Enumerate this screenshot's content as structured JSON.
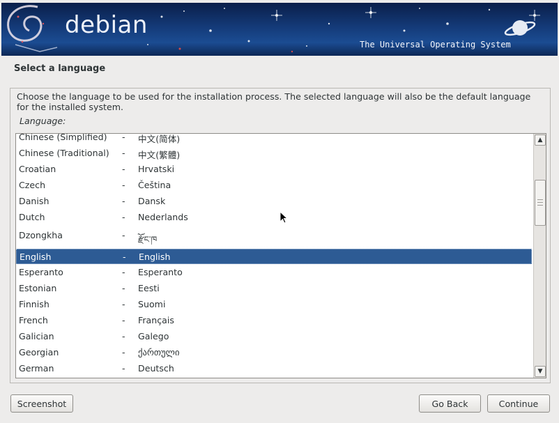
{
  "header": {
    "logo_text": "debian",
    "tagline": "The Universal Operating System"
  },
  "page": {
    "title": "Select a language",
    "description": "Choose the language to be used for the installation process. The selected language will also be the default language for the installed system.",
    "list_label": "Language:"
  },
  "languages": [
    {
      "name": "Chinese (Simplified)",
      "native": "中文(简体)"
    },
    {
      "name": "Chinese (Traditional)",
      "native": "中文(繁體)"
    },
    {
      "name": "Croatian",
      "native": "Hrvatski"
    },
    {
      "name": "Czech",
      "native": "Čeština"
    },
    {
      "name": "Danish",
      "native": "Dansk"
    },
    {
      "name": "Dutch",
      "native": "Nederlands"
    },
    {
      "name": "Dzongkha",
      "native": "རྫོང་ཁ"
    },
    {
      "name": "English",
      "native": "English",
      "selected": true
    },
    {
      "name": "Esperanto",
      "native": "Esperanto"
    },
    {
      "name": "Estonian",
      "native": "Eesti"
    },
    {
      "name": "Finnish",
      "native": "Suomi"
    },
    {
      "name": "French",
      "native": "Français"
    },
    {
      "name": "Galician",
      "native": "Galego"
    },
    {
      "name": "Georgian",
      "native": "ქართული"
    },
    {
      "name": "German",
      "native": "Deutsch"
    }
  ],
  "separator": "-",
  "buttons": {
    "screenshot": "Screenshot",
    "back": "Go Back",
    "continue": "Continue"
  },
  "colors": {
    "selection": "#2d5b94",
    "banner": "#143a78"
  }
}
